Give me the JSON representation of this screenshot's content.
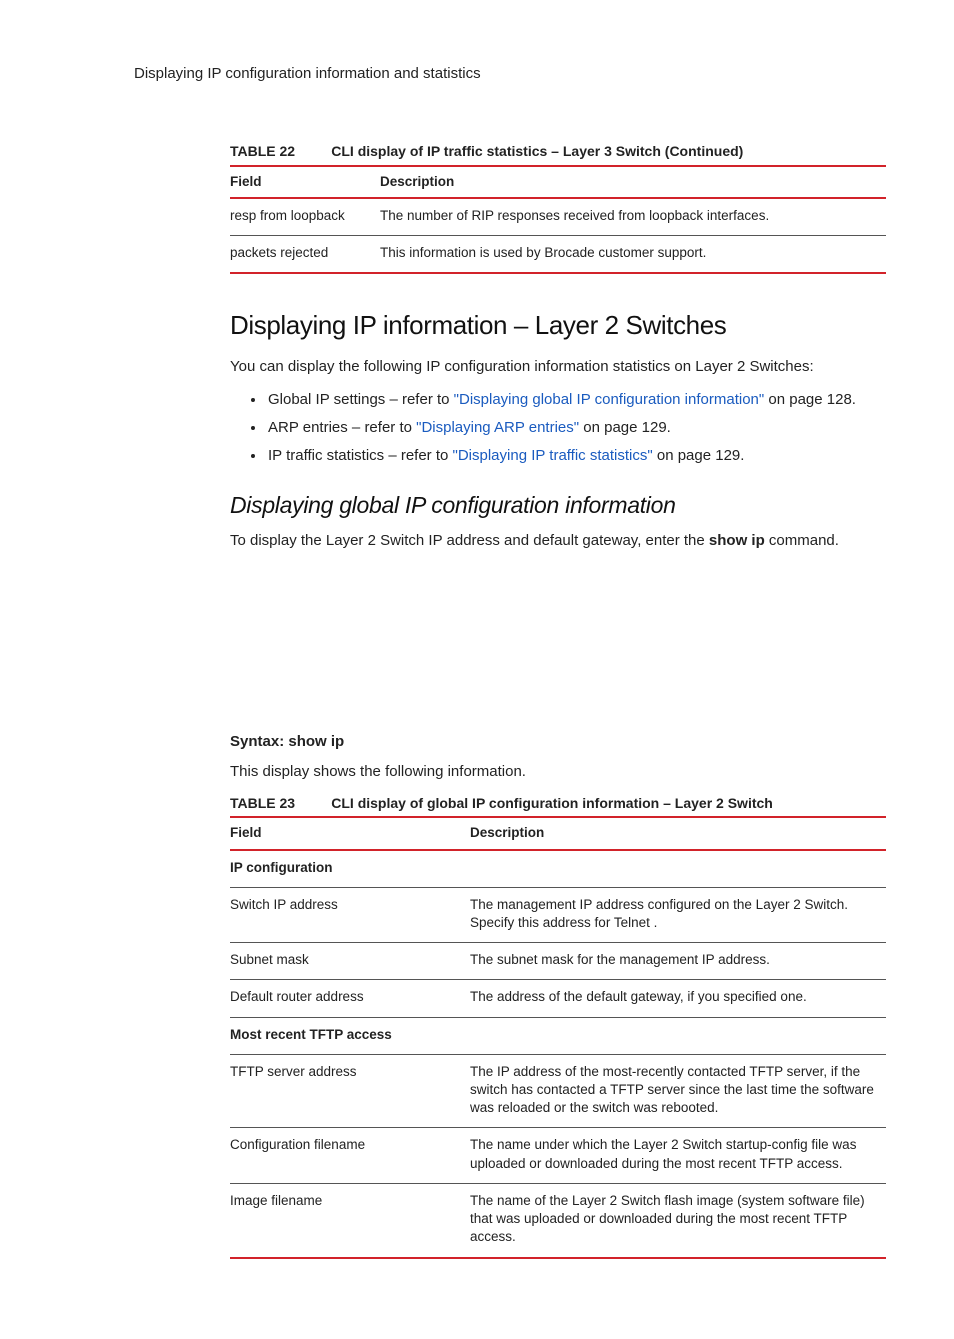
{
  "running_head": "Displaying IP configuration information and statistics",
  "table22": {
    "label": "TABLE 22",
    "title": "CLI display of IP traffic statistics – Layer 3 Switch (Continued)",
    "head_field": "Field",
    "head_desc": "Description",
    "rows": [
      {
        "field": "resp from loopback",
        "desc": "The number of RIP responses received from loopback interfaces."
      },
      {
        "field": "packets rejected",
        "desc": "This information is used by Brocade customer support."
      }
    ]
  },
  "section": {
    "heading": "Displaying IP information – Layer 2 Switches",
    "intro": "You can display the following IP configuration information statistics on Layer 2 Switches:",
    "bullets": [
      {
        "pre": "Global IP settings – refer to ",
        "link": "\"Displaying global IP configuration information\"",
        "post": " on page 128."
      },
      {
        "pre": "ARP entries – refer to ",
        "link": "\"Displaying ARP entries\"",
        "post": " on page 129."
      },
      {
        "pre": "IP traffic statistics – refer to ",
        "link": "\"Displaying IP traffic statistics\"",
        "post": " on page 129."
      }
    ]
  },
  "subsection": {
    "heading": "Displaying global IP configuration information",
    "para_pre": "To display the Layer 2 Switch IP address and default gateway, enter the ",
    "para_cmd": "show ip",
    "para_post": " command."
  },
  "syntax": {
    "label": "Syntax:",
    "cmd": " show ip"
  },
  "after_syntax": "This display shows the following information.",
  "table23": {
    "label": "TABLE 23",
    "title": "CLI display of global IP configuration information – Layer 2 Switch",
    "head_field": "Field",
    "head_desc": "Description",
    "rows": [
      {
        "section": true,
        "field": "IP configuration",
        "desc": ""
      },
      {
        "field": "Switch IP address",
        "desc": "The management IP address configured on the Layer 2 Switch.  Specify this address for Telnet ."
      },
      {
        "field": "Subnet mask",
        "desc": "The subnet mask for the management IP address."
      },
      {
        "field": "Default router address",
        "desc": "The address of the default gateway, if you specified one."
      },
      {
        "section": true,
        "field": "Most recent TFTP access",
        "desc": ""
      },
      {
        "field": "TFTP server address",
        "desc": "The IP address of the most-recently contacted TFTP server, if the switch has contacted a TFTP server since the last time the software was reloaded or the switch was rebooted."
      },
      {
        "field": "Configuration filename",
        "desc": "The name under which the Layer 2 Switch startup-config file was uploaded or downloaded during the most recent TFTP access."
      },
      {
        "field": "Image filename",
        "desc": "The name of the Layer 2 Switch flash image (system software file) that was uploaded or downloaded during the most recent TFTP access."
      }
    ]
  }
}
